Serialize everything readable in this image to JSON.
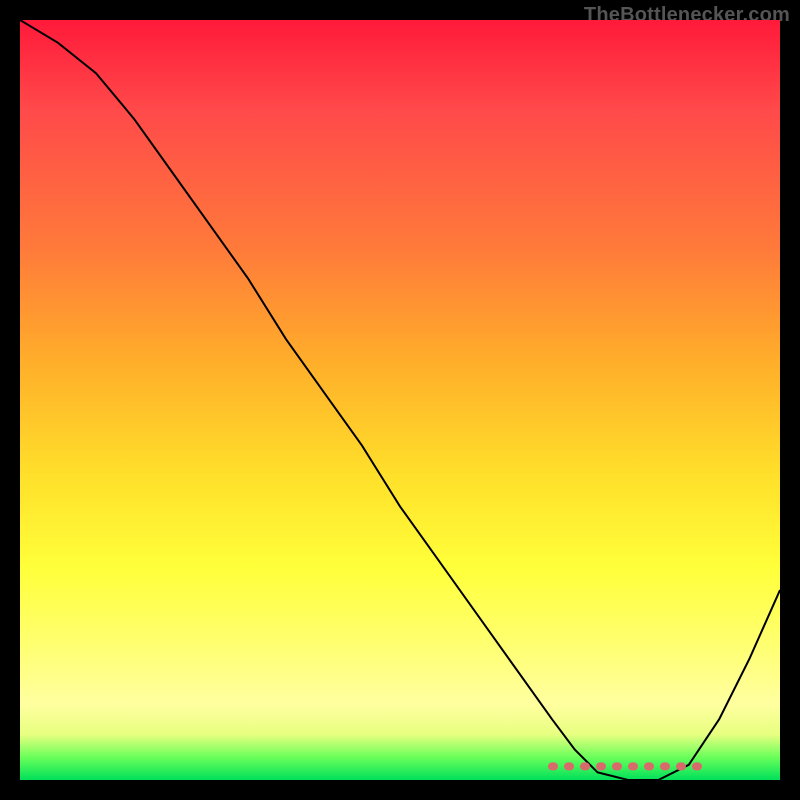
{
  "watermark": "TheBottlenecker.com",
  "chart_data": {
    "type": "line",
    "title": "",
    "xlabel": "",
    "ylabel": "",
    "xlim": [
      0,
      100
    ],
    "ylim": [
      0,
      100
    ],
    "x": [
      0,
      5,
      10,
      15,
      20,
      25,
      30,
      35,
      40,
      45,
      50,
      55,
      60,
      65,
      70,
      73,
      76,
      80,
      84,
      88,
      92,
      96,
      100
    ],
    "values": [
      100,
      97,
      93,
      87,
      80,
      73,
      66,
      58,
      51,
      44,
      36,
      29,
      22,
      15,
      8,
      4,
      1,
      0,
      0,
      2,
      8,
      16,
      25
    ],
    "trough_range_x": [
      70,
      90
    ],
    "trough_y": 1,
    "background_gradient": {
      "top": "#ff1a3a",
      "mid1": "#ffae2a",
      "mid2": "#ffff3a",
      "bottom": "#00e05a"
    },
    "curve_color": "#000000",
    "trough_marker_color": "#d96a6a"
  }
}
